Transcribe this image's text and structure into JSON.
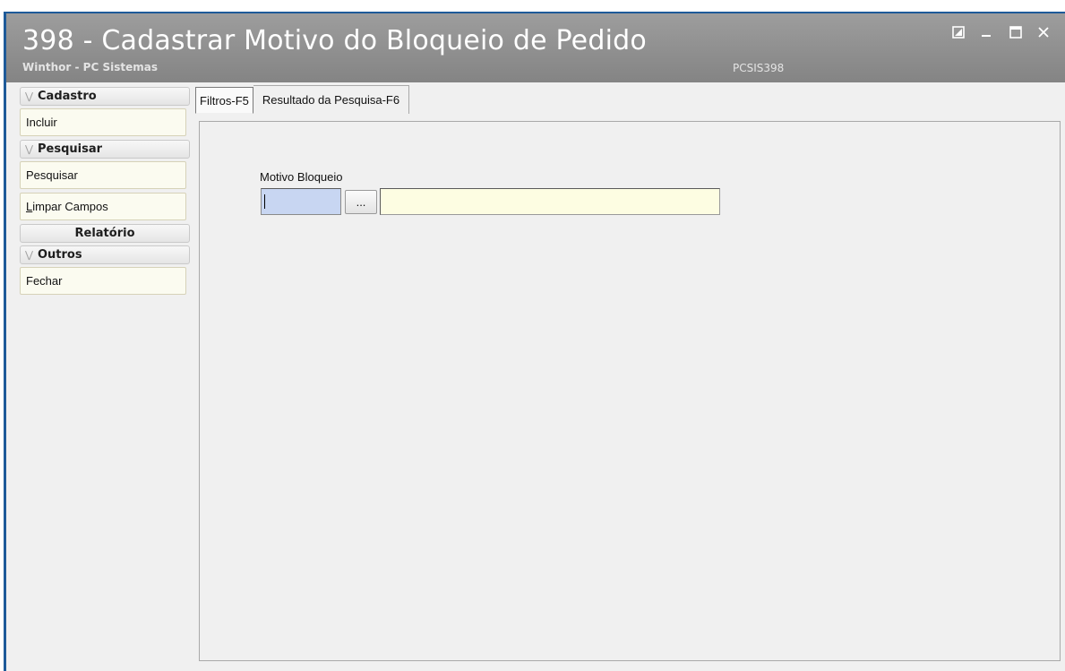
{
  "window": {
    "title": "398 - Cadastrar Motivo do Bloqueio de Pedido",
    "subtitle": "Winthor - PC Sistemas",
    "program_code": "PCSIS398",
    "controls": [
      "restore-icon",
      "minimize-icon",
      "maximize-icon",
      "close-icon"
    ]
  },
  "sidebar": {
    "groups": [
      {
        "header": "Cadastro",
        "icon": "chevron-double-down-icon",
        "items": [
          {
            "label": "Incluir"
          }
        ]
      },
      {
        "header": "Pesquisar",
        "icon": "chevron-double-down-icon",
        "items": [
          {
            "label": "Pesquisar"
          },
          {
            "label_underlined": "L",
            "label_rest": "impar Campos"
          }
        ]
      },
      {
        "header": "Relatório",
        "items": []
      },
      {
        "header": "Outros",
        "icon": "chevron-double-down-icon",
        "items": [
          {
            "label": "Fechar"
          }
        ]
      }
    ]
  },
  "tabs": [
    {
      "label": "Filtros-F5",
      "active": true
    },
    {
      "label": "Resultado da Pesquisa-F6",
      "active": false
    }
  ],
  "filters": {
    "motivo_label": "Motivo Bloqueio",
    "code_value": "",
    "lookup_label": "...",
    "description_value": ""
  },
  "colors": {
    "titlebar": "#8e8e8e",
    "window_border": "#1e5a99",
    "code_input_bg": "#c8d6f2",
    "description_bg": "#fdfde2",
    "side_item_bg": "#fbfbf0"
  }
}
